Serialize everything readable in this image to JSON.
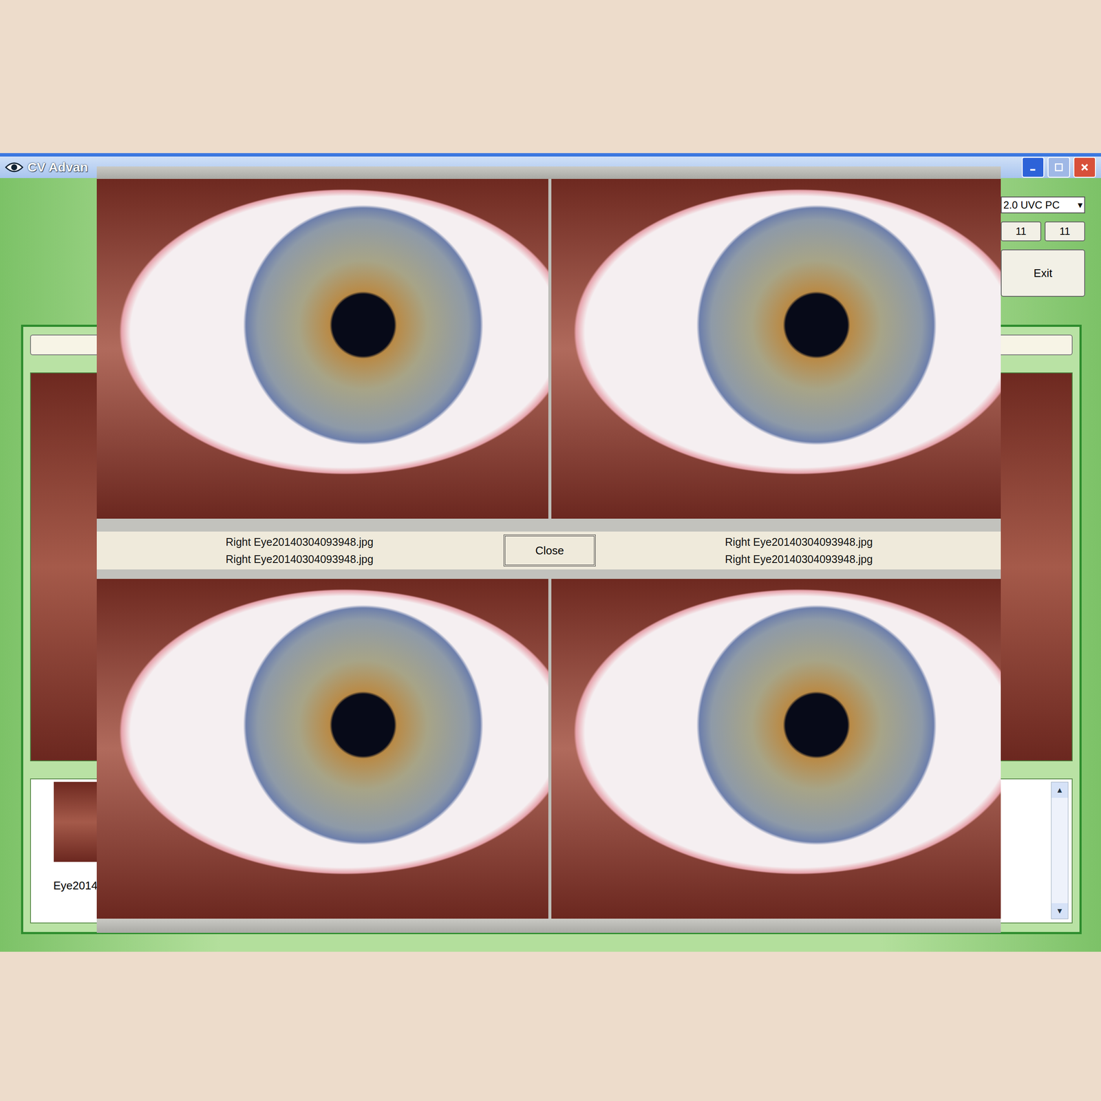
{
  "window": {
    "title": "CV Advan",
    "buttons": {
      "minimize": "false",
      "maximize_disabled": true
    }
  },
  "controls": {
    "device": "2.0 UVC PC",
    "dropdown_arrow": "▾",
    "buttons": [
      "11",
      "11"
    ],
    "exit": "Exit"
  },
  "thumbnail": {
    "caption": "Eye2014"
  },
  "scrollbar": {
    "up": "▲",
    "down": "▼"
  },
  "dialog": {
    "caption_columns": [
      [
        "Right Eye20140304093948.jpg",
        "Right Eye20140304093948.jpg"
      ],
      [
        "Right Eye20140304093948.jpg",
        "Right Eye20140304093948.jpg"
      ]
    ],
    "close": "Close"
  }
}
